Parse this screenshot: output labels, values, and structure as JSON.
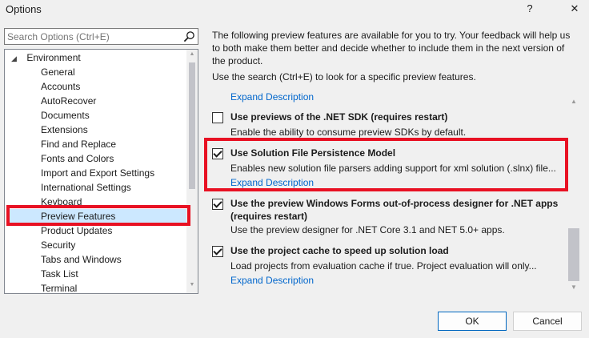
{
  "window": {
    "title": "Options",
    "help_label": "?",
    "close_label": "✕"
  },
  "search": {
    "placeholder": "Search Options (Ctrl+E)"
  },
  "tree": {
    "root": "Environment",
    "items": [
      "General",
      "Accounts",
      "AutoRecover",
      "Documents",
      "Extensions",
      "Find and Replace",
      "Fonts and Colors",
      "Import and Export Settings",
      "International Settings",
      "Keyboard",
      "Preview Features",
      "Product Updates",
      "Security",
      "Tabs and Windows",
      "Task List",
      "Terminal"
    ],
    "selected": "Preview Features"
  },
  "content": {
    "intro": "The following preview features are available for you to try. Your feedback will help us to both make them better and decide whether to include them in the next version of the product.",
    "hint": "Use the search (Ctrl+E) to look for a specific preview features.",
    "expand_label": "Expand Description",
    "options": [
      {
        "title": "Use previews of the .NET SDK (requires restart)",
        "desc": "Enable the ability to consume preview SDKs by default.",
        "checked": false
      },
      {
        "title": "Use Solution File Persistence Model",
        "desc": "Enables new solution file parsers adding support for xml solution (.slnx) file...",
        "checked": true
      },
      {
        "title": "Use the preview Windows Forms out-of-process designer for .NET apps",
        "title2": "(requires restart)",
        "desc": "Use the preview designer for .NET Core 3.1 and NET 5.0+ apps.",
        "checked": true
      },
      {
        "title": "Use the project cache to speed up solution load",
        "desc": "Load projects from evaluation cache if true. Project evaluation will only...",
        "checked": true
      }
    ]
  },
  "buttons": {
    "ok": "OK",
    "cancel": "Cancel"
  },
  "colors": {
    "highlight": "#e81123",
    "link": "#0066cc",
    "selection": "#cce8ff"
  }
}
